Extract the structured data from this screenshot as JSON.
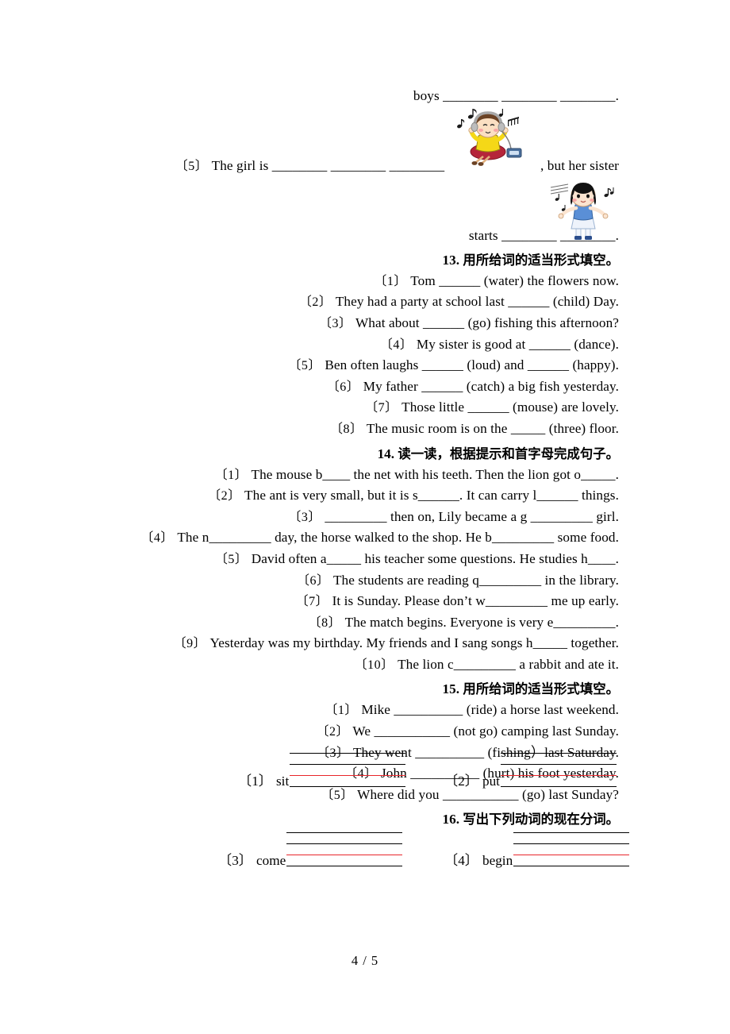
{
  "document": {
    "page_footer": "4 / 5",
    "colors": {
      "text": "#000000",
      "writing_guide_red": "#e8262b",
      "page_background": "#ffffff"
    }
  },
  "top_fragment": {
    "boys_line": "boys ________  ________  ________.",
    "item5_label": "〔5〕",
    "item5_text": "The girl is ________  ________  ________",
    "item5_after_image": ", but her sister",
    "starts_line": "starts ________  ________."
  },
  "illustrations": [
    {
      "name": "girl-listening-to-music",
      "description": "cartoon girl sitting cross-legged wearing headphones with a cassette player and music notes",
      "colors": {
        "hair": "#6b4224",
        "shirt": "#f5d817",
        "skirt": "#b5253a",
        "skin": "#fbdfc2",
        "headphones": "#a8a8a8",
        "notes": "#1a1a1a"
      }
    },
    {
      "name": "girl-singing",
      "description": "cartoon girl with black bob hair in a blue vest and white skirt singing, with music notes",
      "colors": {
        "hair": "#111111",
        "vest": "#5a8fd6",
        "skirt": "#eef3fb",
        "skin": "#fbe4d0",
        "shoes": "#2b4e8c",
        "notes": "#1a1a1a"
      }
    }
  ],
  "sections": [
    {
      "id": "section-13",
      "number": "13.",
      "title_cn": "用所给词的适当形式填空。",
      "items": [
        {
          "label": "〔1〕",
          "text": "Tom ______ (water) the flowers now."
        },
        {
          "label": "〔2〕",
          "text": "They had a party at school last ______ (child) Day."
        },
        {
          "label": "〔3〕",
          "text": "What about ______ (go) fishing this afternoon?"
        },
        {
          "label": "〔4〕",
          "text": "My sister is good at ______ (dance)."
        },
        {
          "label": "〔5〕",
          "text": "Ben often laughs ______ (loud) and ______ (happy)."
        },
        {
          "label": "〔6〕",
          "text": "My father ______ (catch) a big fish yesterday."
        },
        {
          "label": "〔7〕",
          "text": "Those little ______ (mouse) are lovely."
        },
        {
          "label": "〔8〕",
          "text": "The music room is on the _____ (three) floor."
        }
      ]
    },
    {
      "id": "section-14",
      "number": "14.",
      "title_cn": "读一读，根据提示和首字母完成句子。",
      "items": [
        {
          "label": "〔1〕",
          "text": "The mouse b____ the net with his teeth. Then the lion got o_____."
        },
        {
          "label": "〔2〕",
          "text": "The ant is very small, but it is s______. It can carry l______ things."
        },
        {
          "label": "〔3〕",
          "text": "_________ then on, Lily became a g _________ girl."
        },
        {
          "label": "〔4〕",
          "text": "The n_________ day, the horse walked to the shop. He b_________ some food."
        },
        {
          "label": "〔5〕",
          "text": "David often a_____ his teacher some questions. He studies h____."
        },
        {
          "label": "〔6〕",
          "text": "The students are reading q_________ in the library."
        },
        {
          "label": "〔7〕",
          "text": "It is Sunday. Please don’t w_________ me up early."
        },
        {
          "label": "〔8〕",
          "text": "The match begins. Everyone is very e_________."
        },
        {
          "label": "〔9〕",
          "text": "Yesterday was my birthday. My friends and I sang songs h_____ together."
        },
        {
          "label": "〔10〕",
          "text": "The lion c_________ a rabbit and ate it."
        }
      ]
    },
    {
      "id": "section-15",
      "number": "15.",
      "title_cn": "用所给词的适当形式填空。",
      "items": [
        {
          "label": "〔1〕",
          "text": "Mike __________ (ride) a horse last weekend."
        },
        {
          "label": "〔2〕",
          "text": "We ___________ (not go) camping last Sunday."
        },
        {
          "label": "〔3〕",
          "text": "They went __________ (fishing）last Saturday."
        },
        {
          "label": "〔4〕",
          "text": "John __________ (hurt) his foot yesterday."
        },
        {
          "label": "〔5〕",
          "text": "Where did you ___________ (go) last Sunday?"
        }
      ]
    },
    {
      "id": "section-16",
      "number": "16.",
      "title_cn": "写出下列动词的现在分词。",
      "verbs": [
        {
          "label": "〔1〕",
          "word": "sit"
        },
        {
          "label": "〔2〕",
          "word": "put"
        },
        {
          "label": "〔3〕",
          "word": "come"
        },
        {
          "label": "〔4〕",
          "word": "begin"
        }
      ]
    }
  ]
}
